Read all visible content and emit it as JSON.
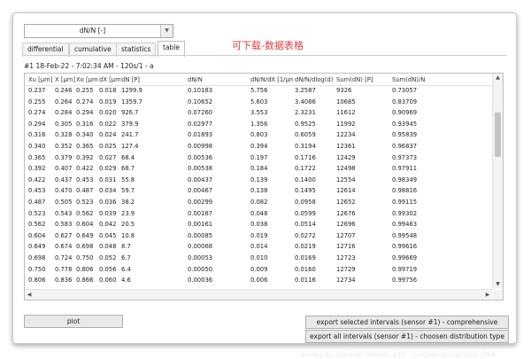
{
  "dropdown": {
    "value": "dN/N [-]"
  },
  "tabs": [
    {
      "label": "differential",
      "active": false
    },
    {
      "label": "cumulative",
      "active": false
    },
    {
      "label": "statistics",
      "active": false
    },
    {
      "label": "table",
      "active": true
    }
  ],
  "annotation": "可下载-数据表格",
  "info": "#1 18-Feb-22 - 7:02:34 AM - 120s/1 - a",
  "table": {
    "columns": [
      "Xu [µm]",
      "X [µm]",
      "Xo [µm]",
      "dX [µm]",
      "dN [P]",
      "dN/N",
      "dN/N/dX [1/µm]",
      "dN/N/dlog(d)",
      "Sum(dN) [P]",
      "Sum(dN)/N"
    ],
    "rows": [
      [
        "0.237",
        "0.246",
        "0.255",
        "0.018",
        "1299.9",
        "0.10183",
        "5.756",
        "3.2587",
        "9326",
        "0.73057"
      ],
      [
        "0.255",
        "0.264",
        "0.274",
        "0.019",
        "1359.7",
        "0.10652",
        "5.603",
        "3.4086",
        "10685",
        "0.83709"
      ],
      [
        "0.274",
        "0.284",
        "0.294",
        "0.020",
        "926.7",
        "0.07260",
        "3.553",
        "2.3231",
        "11612",
        "0.90969"
      ],
      [
        "0.294",
        "0.305",
        "0.316",
        "0.022",
        "379.9",
        "0.02977",
        "1.356",
        "0.9525",
        "11992",
        "0.93945"
      ],
      [
        "0.316",
        "0.328",
        "0.340",
        "0.024",
        "241.7",
        "0.01893",
        "0.803",
        "0.6059",
        "12234",
        "0.95839"
      ],
      [
        "0.340",
        "0.352",
        "0.365",
        "0.025",
        "127.4",
        "0.00998",
        "0.394",
        "0.3194",
        "12361",
        "0.96837"
      ],
      [
        "0.365",
        "0.379",
        "0.392",
        "0.027",
        "68.4",
        "0.00536",
        "0.197",
        "0.1716",
        "12429",
        "0.97373"
      ],
      [
        "0.392",
        "0.407",
        "0.422",
        "0.029",
        "68.7",
        "0.00538",
        "0.184",
        "0.1722",
        "12498",
        "0.97911"
      ],
      [
        "0.422",
        "0.437",
        "0.453",
        "0.031",
        "55.8",
        "0.00437",
        "0.139",
        "0.1400",
        "12554",
        "0.98349"
      ],
      [
        "0.453",
        "0.470",
        "0.487",
        "0.034",
        "59.7",
        "0.00467",
        "0.138",
        "0.1495",
        "12614",
        "0.98816"
      ],
      [
        "0.487",
        "0.505",
        "0.523",
        "0.036",
        "38.2",
        "0.00299",
        "0.082",
        "0.0958",
        "12652",
        "0.99115"
      ],
      [
        "0.523",
        "0.543",
        "0.562",
        "0.039",
        "23.9",
        "0.00187",
        "0.048",
        "0.0599",
        "12676",
        "0.99302"
      ],
      [
        "0.562",
        "0.583",
        "0.604",
        "0.042",
        "20.5",
        "0.00161",
        "0.038",
        "0.0514",
        "12696",
        "0.99463"
      ],
      [
        "0.604",
        "0.627",
        "0.649",
        "0.045",
        "10.8",
        "0.00085",
        "0.019",
        "0.0272",
        "12707",
        "0.99548"
      ],
      [
        "0.649",
        "0.674",
        "0.698",
        "0.048",
        "8.7",
        "0.00068",
        "0.014",
        "0.0219",
        "12716",
        "0.99616"
      ],
      [
        "0.698",
        "0.724",
        "0.750",
        "0.052",
        "6.7",
        "0.00053",
        "0.010",
        "0.0169",
        "12723",
        "0.99669"
      ],
      [
        "0.750",
        "0.778",
        "0.806",
        "0.056",
        "6.4",
        "0.00050",
        "0.009",
        "0.0160",
        "12729",
        "0.99719"
      ],
      [
        "0.806",
        "0.836",
        "0.866",
        "0.060",
        "4.6",
        "0.00036",
        "0.006",
        "0.0116",
        "12734",
        "0.99756"
      ]
    ]
  },
  "buttons": {
    "plot": "plot",
    "export_selected": "export selected intervals (sensor #1) - comprehensive",
    "export_all": "export all intervals (sensor #1) - choosen distribution type"
  },
  "icons": {
    "dropdown": "triangle-down-icon",
    "scroll_up": "caret-up-icon",
    "scroll_down": "caret-down-icon",
    "scroll_left": "caret-left-icon",
    "scroll_right": "caret-right-icon"
  },
  "colors": {
    "annotation": "#e53c3c",
    "thumb": "#c4c4c4"
  }
}
